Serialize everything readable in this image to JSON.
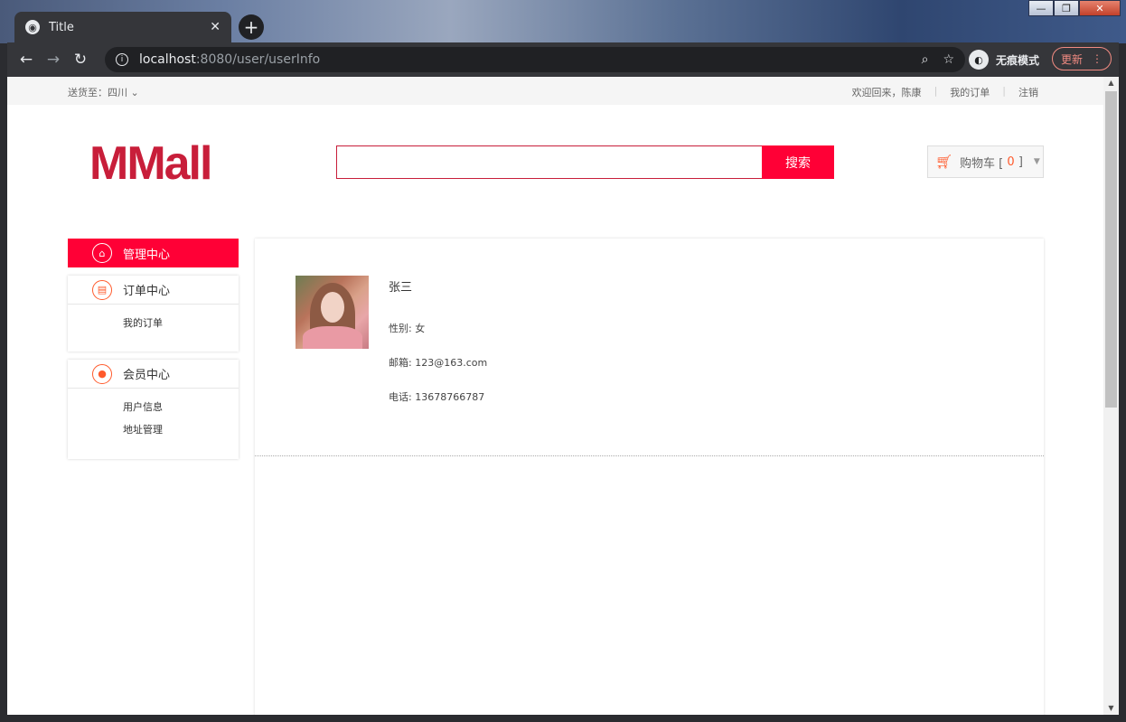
{
  "browser": {
    "tab_title": "Title",
    "tab_close": "✕",
    "new_tab": "+",
    "url_host": "localhost",
    "url_path": ":8080/user/userInfo",
    "incognito_label": "无痕模式",
    "update_label": "更新"
  },
  "topbar": {
    "ship_to_label": "送货至：",
    "ship_to_value": "四川",
    "welcome": "欢迎回来，陈康",
    "my_orders": "我的订单",
    "logout": "注销"
  },
  "header": {
    "logo": "MMall",
    "search_placeholder": "",
    "search_button": "搜索",
    "cart_label": "购物车 [",
    "cart_count": "0",
    "cart_close": "]"
  },
  "sidebar": {
    "manage_center": "管理中心",
    "order_center": "订单中心",
    "order_items": [
      "我的订单"
    ],
    "member_center": "会员中心",
    "member_items": [
      "用户信息",
      "地址管理"
    ]
  },
  "profile": {
    "name": "张三",
    "gender": "性别: 女",
    "email": "邮箱: 123@163.com",
    "phone": "电话: 13678766787"
  },
  "colors": {
    "brand": "#c81e3a",
    "accent": "#ff0036",
    "icon_orange": "#ff5a2c"
  }
}
